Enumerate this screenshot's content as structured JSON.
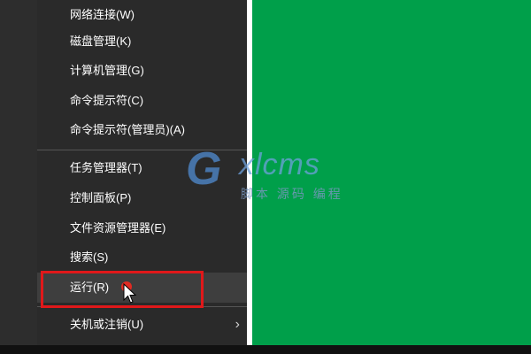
{
  "menu": {
    "items": [
      {
        "label": "网络连接(W)"
      },
      {
        "label": "磁盘管理(K)"
      },
      {
        "label": "计算机管理(G)"
      },
      {
        "label": "命令提示符(C)"
      },
      {
        "label": "命令提示符(管理员)(A)"
      },
      {
        "label": "任务管理器(T)"
      },
      {
        "label": "控制面板(P)"
      },
      {
        "label": "文件资源管理器(E)"
      },
      {
        "label": "搜索(S)"
      },
      {
        "label": "运行(R)"
      },
      {
        "label": "关机或注销(U)"
      }
    ],
    "submenu_icon": "chevron-right-icon",
    "submenu_glyph": "›",
    "highlighted": "运行(R)"
  },
  "watermark": {
    "logo": "G",
    "brand": "xlcms",
    "subtitle": "脚本 源码 编程"
  },
  "colors": {
    "desktop": "#009f4a",
    "menu_bg": "#2a2a2a",
    "highlight_border": "#e0181a",
    "hover_bg": "#3e3e3e"
  }
}
